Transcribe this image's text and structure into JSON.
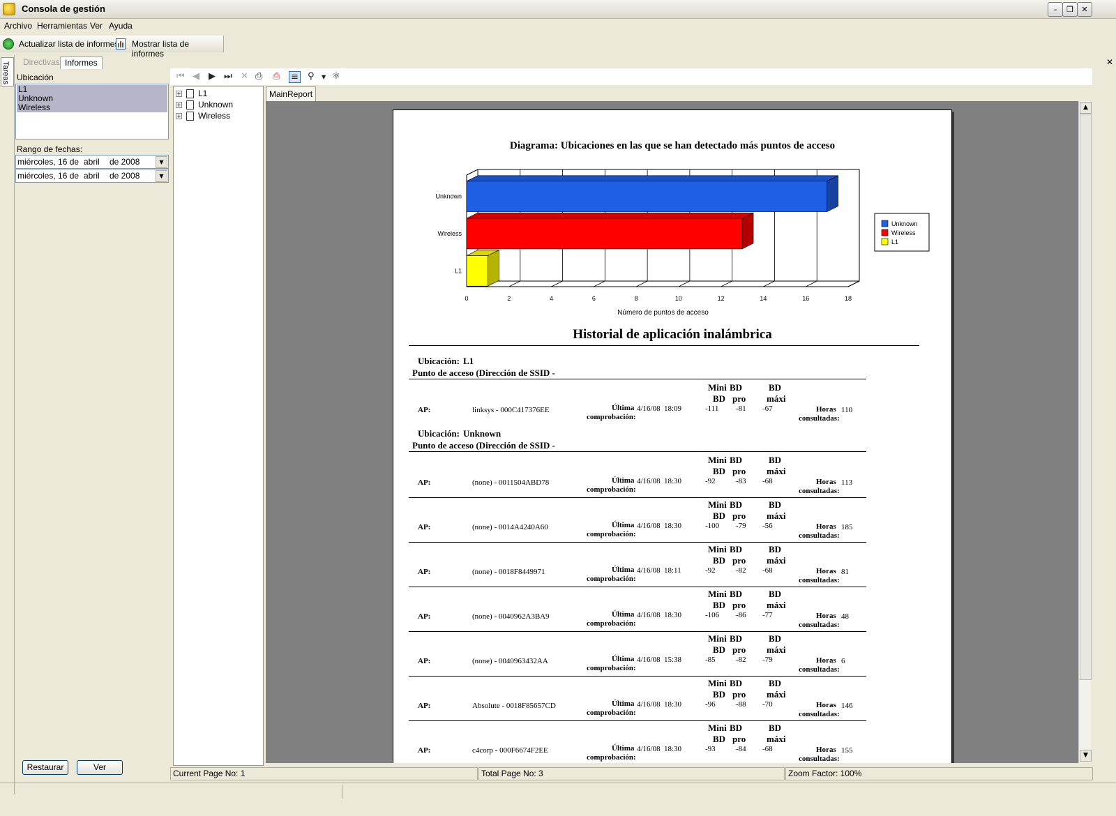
{
  "window": {
    "title": "Consola de gestión"
  },
  "menu": [
    "Archivo",
    "Herramientas",
    "Ver",
    "Ayuda"
  ],
  "toolbar": {
    "refresh_label": "Actualizar lista de informes",
    "show_label": "Mostrar lista de informes"
  },
  "side_tab": "Tareas",
  "tabs": {
    "directivas": "Directivas",
    "informes": "Informes"
  },
  "left": {
    "ubicacion_label": "Ubicación",
    "locations": [
      "L1",
      "Unknown",
      "Wireless"
    ],
    "rango_label": "Rango de fechas:",
    "date1": {
      "weekday": "miércoles, 16 de",
      "month": "abril",
      "year": "de 2008"
    },
    "date2": {
      "weekday": "miércoles, 16 de",
      "month": "abril",
      "year": "de 2008"
    },
    "restaurar": "Restaurar",
    "ver": "Ver"
  },
  "tree": [
    "L1",
    "Unknown",
    "Wireless"
  ],
  "report_tab": "MainReport",
  "chart_data": {
    "type": "bar",
    "orientation": "horizontal",
    "title": "Diagrama: Ubicaciones en las que se han detectado más puntos de acceso",
    "categories": [
      "Unknown",
      "Wireless",
      "L1"
    ],
    "values": [
      17,
      13,
      1
    ],
    "colors": [
      "#1f5fe6",
      "#ff0000",
      "#ffff00"
    ],
    "xlabel": "Número de puntos de acceso",
    "xlim": [
      0,
      18
    ],
    "ticks": [
      "0",
      "2",
      "4",
      "6",
      "8",
      "10",
      "12",
      "14",
      "16",
      "18"
    ],
    "legend": [
      "Unknown",
      "Wireless",
      "L1"
    ],
    "legend_position": "right",
    "grid": true
  },
  "report": {
    "title": "Historial de aplicación inalámbrica",
    "ubic_label": "Ubicación:",
    "punto_label": "Punto de acceso (Dirección de SSID -",
    "ap_label": "AP:",
    "ultima": "Última",
    "comprobacion": "comprobación:",
    "horas": "Horas",
    "consultadas": "consultadas:",
    "h_min1": "Mini",
    "h_min2": "BD",
    "h_pro1": "BD",
    "h_pro2": "pro",
    "h_max1": "BD",
    "h_max2": "máxi",
    "sections": [
      {
        "location": "L1",
        "rows": [
          {
            "ap": "linksys - 000C417376EE",
            "date": "4/16/08",
            "time": "18:09",
            "min": "-111",
            "pro": "-81",
            "max": "-67",
            "hours": "110"
          }
        ]
      },
      {
        "location": "Unknown",
        "rows": [
          {
            "ap": "(none) - 0011504ABD78",
            "date": "4/16/08",
            "time": "18:30",
            "min": "-92",
            "pro": "-83",
            "max": "-68",
            "hours": "113"
          },
          {
            "ap": "(none) - 0014A4240A60",
            "date": "4/16/08",
            "time": "18:30",
            "min": "-100",
            "pro": "-79",
            "max": "-56",
            "hours": "185"
          },
          {
            "ap": "(none) - 0018F8449971",
            "date": "4/16/08",
            "time": "18:11",
            "min": "-92",
            "pro": "-82",
            "max": "-68",
            "hours": "81"
          },
          {
            "ap": "(none) - 0040962A3BA9",
            "date": "4/16/08",
            "time": "18:30",
            "min": "-106",
            "pro": "-86",
            "max": "-77",
            "hours": "48"
          },
          {
            "ap": "(none) - 0040963432AA",
            "date": "4/16/08",
            "time": "15:38",
            "min": "-85",
            "pro": "-82",
            "max": "-79",
            "hours": "6"
          },
          {
            "ap": "Absolute - 0018F85657CD",
            "date": "4/16/08",
            "time": "18:30",
            "min": "-96",
            "pro": "-88",
            "max": "-70",
            "hours": "146"
          },
          {
            "ap": "c4corp - 000F6674F2EE",
            "date": "4/16/08",
            "time": "18:30",
            "min": "-93",
            "pro": "-84",
            "max": "-68",
            "hours": "155"
          }
        ]
      }
    ]
  },
  "status": {
    "current": "Current Page No: 1",
    "total": "Total Page No: 3",
    "zoom": "Zoom Factor: 100%"
  }
}
